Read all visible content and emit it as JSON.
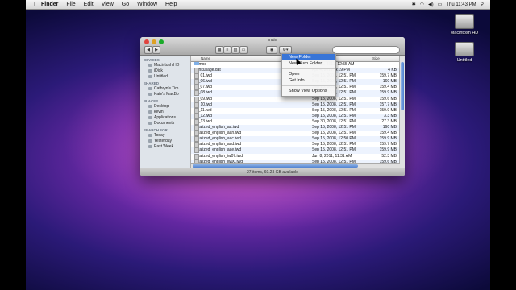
{
  "menubar": {
    "apple": "",
    "items": [
      "Finder",
      "File",
      "Edit",
      "View",
      "Go",
      "Window",
      "Help"
    ],
    "clock": "Thu 11:43 PM"
  },
  "desktop": {
    "icons": [
      "Macintosh HD",
      "Untitled"
    ]
  },
  "window": {
    "title": "main",
    "search_placeholder": "",
    "status": "27 items, 60.23 GB available"
  },
  "sidebar": {
    "devices_header": "DEVICES",
    "devices": [
      "Macintosh HD",
      "iDisk",
      "Untitled"
    ],
    "shared_header": "SHARED",
    "shared": [
      "Cathryn's Tim",
      "Kate's MacBo"
    ],
    "places_header": "PLACES",
    "places": [
      "Desktop",
      "kevin",
      "Applications",
      "Documents"
    ],
    "search_header": "SEARCH FOR",
    "search": [
      "Today",
      "Yesterday",
      "Past Week"
    ]
  },
  "columns": {
    "name": "Name",
    "modified": "Date Modified",
    "size": "Size"
  },
  "files": [
    {
      "name": "demos",
      "date": "Jan 31, 2011, 12:55 AM",
      "size": "--"
    },
    {
      "name": "hunkusage.dat",
      "date": "Apr 4, 2011, 4:19 PM",
      "size": "4 KB"
    },
    {
      "name": "iw_01.iwd",
      "date": "Sep 15, 2008, 12:51 PM",
      "size": "159.7 MB"
    },
    {
      "name": "iw_06.iwd",
      "date": "Sep 15, 2008, 12:51 PM",
      "size": "160 MB"
    },
    {
      "name": "iw_07.iwd",
      "date": "Sep 15, 2008, 12:51 PM",
      "size": "159.4 MB"
    },
    {
      "name": "iw_08.iwd",
      "date": "Sep 15, 2008, 12:51 PM",
      "size": "159.9 MB"
    },
    {
      "name": "iw_09.iwd",
      "date": "Sep 15, 2008, 12:51 PM",
      "size": "159.6 MB"
    },
    {
      "name": "iw_10.iwd",
      "date": "Sep 15, 2008, 12:51 PM",
      "size": "157.7 MB"
    },
    {
      "name": "iw_11.iwd",
      "date": "Sep 15, 2008, 12:51 PM",
      "size": "159.9 MB"
    },
    {
      "name": "iw_12.iwd",
      "date": "Sep 15, 2008, 12:51 PM",
      "size": "3.3 MB"
    },
    {
      "name": "iw_13.iwd",
      "date": "Sep 30, 2008, 12:51 PM",
      "size": "27.3 MB"
    },
    {
      "name": "localized_english_aa.iwd",
      "date": "Sep 15, 2008, 12:51 PM",
      "size": "160 MB"
    },
    {
      "name": "localized_english_aah.iwd",
      "date": "Sep 15, 2008, 12:51 PM",
      "size": "159.4 MB"
    },
    {
      "name": "localized_english_aac.iwd",
      "date": "Sep 15, 2008, 12:50 PM",
      "size": "159.9 MB"
    },
    {
      "name": "localized_english_aad.iwd",
      "date": "Sep 15, 2008, 12:51 PM",
      "size": "159.7 MB"
    },
    {
      "name": "localized_english_aae.iwd",
      "date": "Sep 15, 2008, 12:51 PM",
      "size": "159.9 MB"
    },
    {
      "name": "localized_english_iw07.iwd",
      "date": "Jun 8, 2011, 11:31 AM",
      "size": "52.3 MB"
    },
    {
      "name": "localized_english_iw00.iwd",
      "date": "Sep 15, 2008, 12:51 PM",
      "size": "159.6 MB"
    }
  ],
  "context_menu": [
    "New Folder",
    "New Burn Folder",
    "Open",
    "Get Info",
    "Show View Options"
  ]
}
